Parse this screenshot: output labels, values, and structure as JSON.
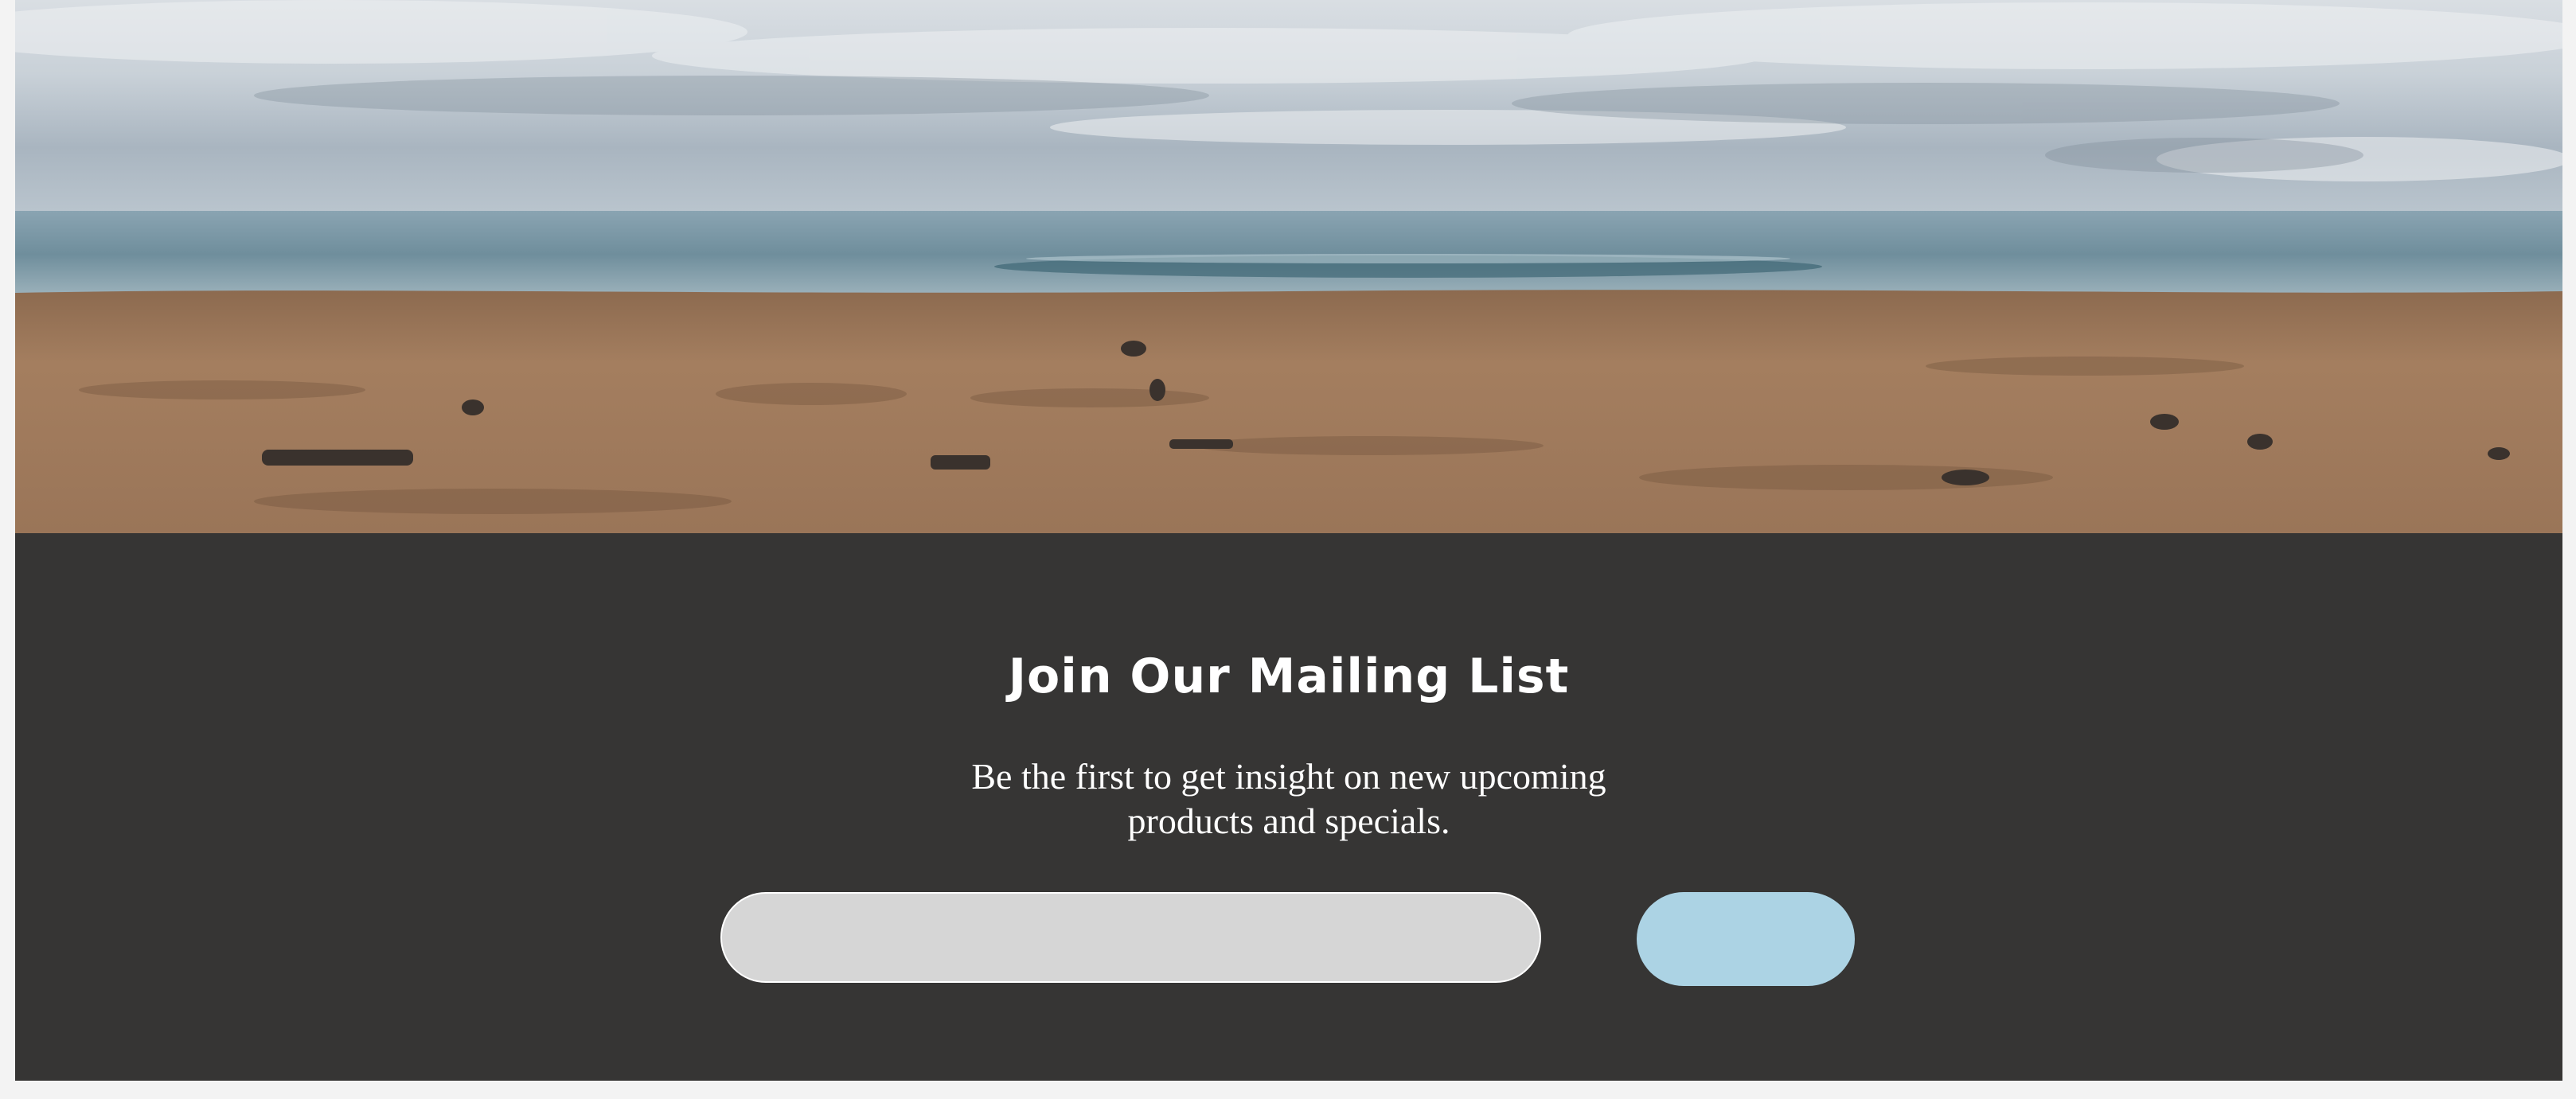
{
  "hero": {
    "image_label": "beach-scene"
  },
  "newsletter": {
    "title": "Join Our Mailing List",
    "subtitle": "Be the first to get insight on new upcoming products and specials.",
    "email_input": {
      "value": "",
      "placeholder": ""
    },
    "submit_label": ""
  },
  "colors": {
    "section_background": "#363534",
    "input_background": "#d6d6d6",
    "button_background": "#acd3e4",
    "text": "#ffffff"
  }
}
